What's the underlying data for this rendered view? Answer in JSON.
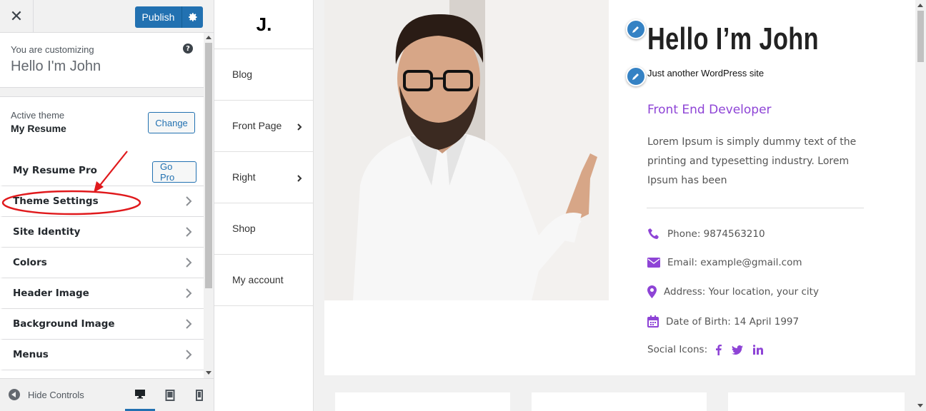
{
  "customizer": {
    "close_label": "✕",
    "publish_label": "Publish",
    "info": {
      "customizing_label": "You are customizing",
      "site_name": "Hello I'm John"
    },
    "theme": {
      "active_label": "Active theme",
      "name": "My Resume",
      "change_label": "Change"
    },
    "sections": [
      {
        "label": "My Resume Pro",
        "button": "Go Pro"
      },
      {
        "label": "Theme Settings"
      },
      {
        "label": "Site Identity"
      },
      {
        "label": "Colors"
      },
      {
        "label": "Header Image"
      },
      {
        "label": "Background Image"
      },
      {
        "label": "Menus"
      }
    ],
    "footer": {
      "hide_controls_label": "Hide Controls",
      "devices": [
        "desktop",
        "tablet",
        "mobile"
      ],
      "active_device": "desktop"
    },
    "annotation_color": "#e0191c"
  },
  "preview": {
    "logo": "J.",
    "nav": [
      {
        "label": "Blog",
        "has_submenu": false
      },
      {
        "label": "Front Page",
        "has_submenu": true
      },
      {
        "label": "Right",
        "has_submenu": true
      },
      {
        "label": "Shop",
        "has_submenu": false
      },
      {
        "label": "My account",
        "has_submenu": false
      }
    ],
    "title": "Hello I’m John",
    "tagline": "Just another WordPress site",
    "role": "Front End Developer",
    "bio": "Lorem Ipsum is simply dummy text of the printing and typesetting industry. Lorem Ipsum has been",
    "info": {
      "phone": "Phone: 9874563210",
      "email": "Email: example@gmail.com",
      "address": "Address: Your location, your city",
      "dob": "Date of Birth: 14 April 1997"
    },
    "social_label": "Social Icons:",
    "social_icons": [
      "facebook-icon",
      "twitter-icon",
      "linkedin-icon"
    ],
    "accent_color": "#8e44d6",
    "wp_blue": "#2271b1"
  }
}
